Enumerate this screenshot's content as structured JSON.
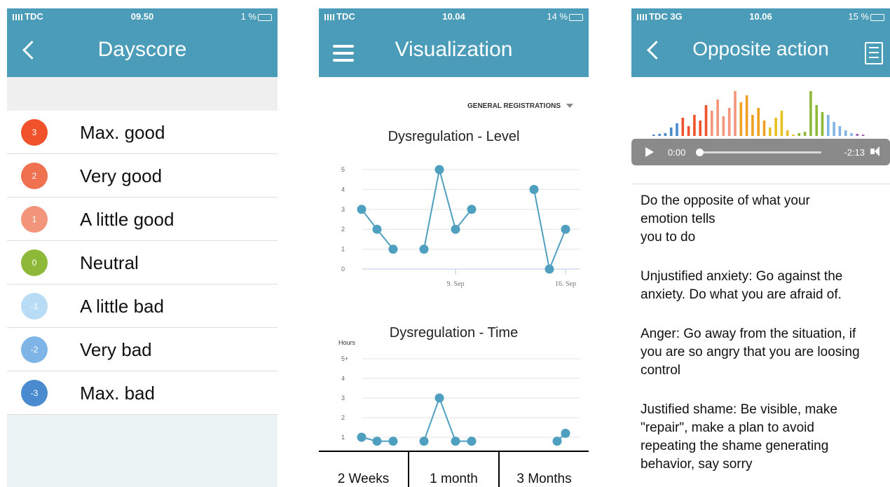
{
  "phone1": {
    "status": {
      "carrier": "TDC",
      "time": "09.50",
      "battery": "1 %"
    },
    "title": "Dayscore",
    "items": [
      {
        "value": "3",
        "label": "Max. good",
        "color": "#f0522c"
      },
      {
        "value": "2",
        "label": "Very good",
        "color": "#f0714f"
      },
      {
        "value": "1",
        "label": "A little good",
        "color": "#f3957a"
      },
      {
        "value": "0",
        "label": "Neutral",
        "color": "#8db838"
      },
      {
        "value": "-1",
        "label": "A little bad",
        "color": "#b8dcf5"
      },
      {
        "value": "-2",
        "label": "Very bad",
        "color": "#7fb5e6"
      },
      {
        "value": "-3",
        "label": "Max. bad",
        "color": "#4a8bd0"
      }
    ]
  },
  "phone2": {
    "status": {
      "carrier": "TDC",
      "time": "10.04",
      "battery": "14 %"
    },
    "title": "Visualization",
    "dropdown": "GENERAL REGISTRATIONS",
    "tabs": [
      "2 Weeks",
      "1 month",
      "3 Months"
    ]
  },
  "phone3": {
    "status": {
      "carrier": "TDC 3G",
      "time": "10.06",
      "battery": "15 %"
    },
    "title": "Opposite action",
    "player": {
      "elapsed": "0:00",
      "remaining": "-2:13",
      "progress": 0
    },
    "paragraphs": [
      [
        "Do the opposite of what your",
        "emotion tells",
        "you to do"
      ],
      [
        "Unjustified anxiety: Go against the",
        "anxiety. Do what you are afraid of."
      ],
      [
        "Anger: Go away from the situation, if",
        "you are so angry that you are loosing",
        "control"
      ],
      [
        "Justified shame: Be visible, make",
        "\"repair\", make a plan to avoid",
        "repeating the shame generating",
        "behavior,  say sorry"
      ]
    ]
  },
  "chart_data": [
    {
      "type": "line",
      "title": "Dysregulation - Level",
      "ylabel": "",
      "ylim": [
        0,
        5
      ],
      "yticks": [
        "0",
        "1",
        "2",
        "3",
        "4",
        "5"
      ],
      "xtick_labels": [
        "9. Sep",
        "16. Sep"
      ],
      "series": [
        {
          "values": [
            3,
            2,
            1
          ]
        },
        {
          "values": [
            1,
            5,
            2,
            3
          ]
        },
        {
          "values": [
            4,
            0,
            2
          ]
        }
      ],
      "color": "#4e9fc0"
    },
    {
      "type": "line",
      "title": "Dysregulation - Time",
      "ylabel": "Hours",
      "ylim": [
        0,
        5
      ],
      "yticks": [
        "1",
        "2",
        "3",
        "4",
        "5+"
      ],
      "series": [
        {
          "values": [
            1,
            0.8,
            0.8
          ]
        },
        {
          "values": [
            0.8,
            3,
            0.8,
            0.8
          ]
        },
        {
          "values": [
            0.8,
            1.2
          ]
        }
      ],
      "color": "#4e9fc0"
    }
  ]
}
